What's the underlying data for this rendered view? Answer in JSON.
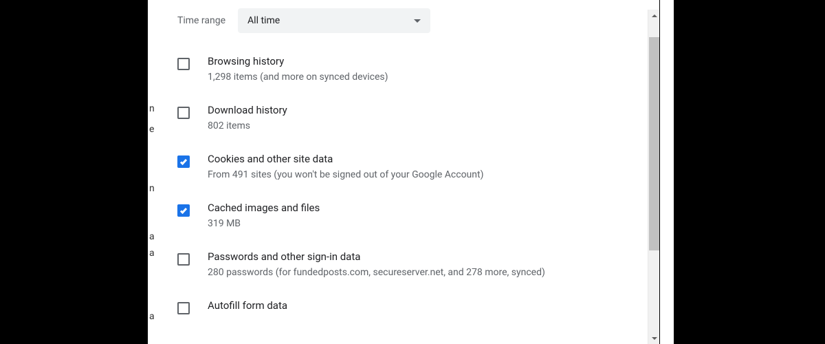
{
  "timeRange": {
    "label": "Time range",
    "selected": "All time"
  },
  "options": [
    {
      "title": "Browsing history",
      "desc": "1,298 items (and more on synced devices)",
      "checked": false
    },
    {
      "title": "Download history",
      "desc": "802 items",
      "checked": false
    },
    {
      "title": "Cookies and other site data",
      "desc": "From 491 sites (you won't be signed out of your Google Account)",
      "checked": true
    },
    {
      "title": "Cached images and files",
      "desc": "319 MB",
      "checked": true
    },
    {
      "title": "Passwords and other sign-in data",
      "desc": "280 passwords (for fundedposts.com, secureserver.net, and 278 more, synced)",
      "checked": false
    },
    {
      "title": "Autofill form data",
      "desc": "",
      "checked": false
    }
  ]
}
